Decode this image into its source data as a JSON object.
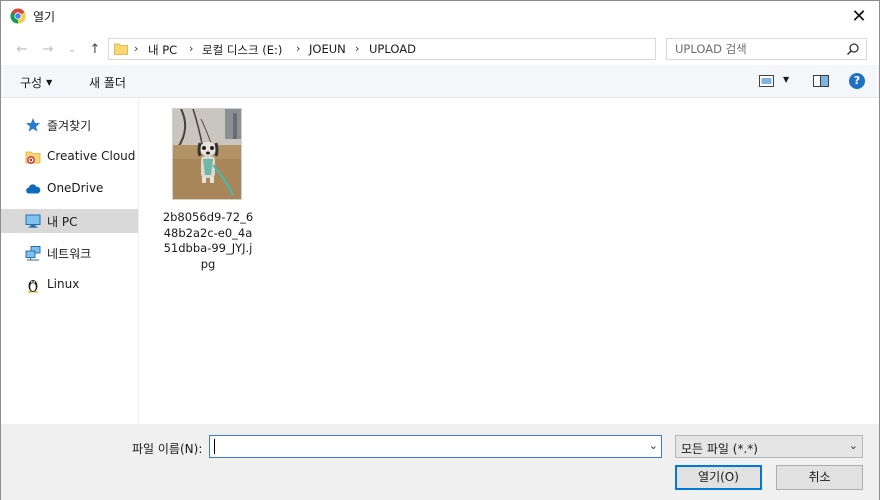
{
  "window": {
    "title": "열기",
    "close_glyph": "✕"
  },
  "navigation": {
    "back_glyph": "←",
    "forward_glyph": "→",
    "recent_glyph": "⌄",
    "up_glyph": "↑"
  },
  "address": {
    "crumbs": [
      "내 PC",
      "로컬 디스크 (E:)",
      "JOEUN",
      "UPLOAD"
    ],
    "separator": "›",
    "dropdown_glyph": "⌄",
    "refresh_glyph": "↻"
  },
  "search": {
    "placeholder": "UPLOAD 검색"
  },
  "toolbar": {
    "organize_label": "구성",
    "new_folder_label": "새 폴더",
    "caret": "▼",
    "help_label": "?"
  },
  "sidebar": {
    "items": [
      {
        "label": "즐겨찾기",
        "icon": "star-icon"
      },
      {
        "label": "Creative Cloud Files",
        "icon": "creative-cloud-folder-icon"
      },
      {
        "label": "OneDrive",
        "icon": "cloud-icon"
      },
      {
        "label": "내 PC",
        "icon": "computer-icon",
        "selected": true
      },
      {
        "label": "네트워크",
        "icon": "network-icon"
      },
      {
        "label": "Linux",
        "icon": "linux-icon"
      }
    ]
  },
  "files": [
    {
      "name": "2b8056d9-72_648b2a2c-e0_4a51dbba-99_JYJ.jpg",
      "type": "jpg-image"
    }
  ],
  "bottom": {
    "filename_label": "파일 이름(N):",
    "filename_value": "",
    "filetype_value": "모든 파일 (*.*)",
    "dropdown_glyph": "⌄",
    "open_label": "열기(O)",
    "cancel_label": "취소"
  },
  "colors": {
    "accent": "#0078d7",
    "toolbar_bg": "#f4f6f9",
    "footer_bg": "#f0f0f0",
    "selected_bg": "#d9d9d9"
  }
}
